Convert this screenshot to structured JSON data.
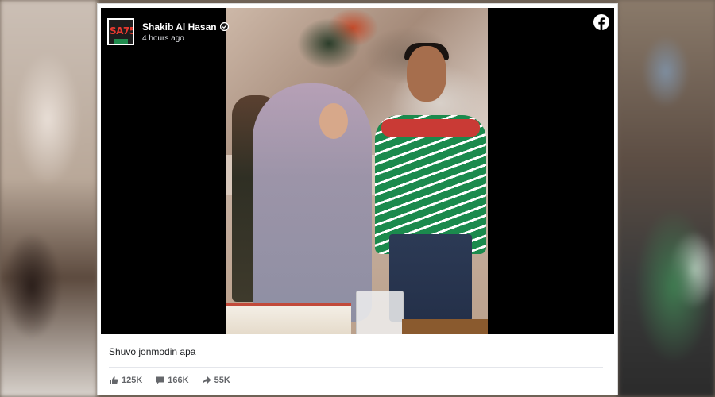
{
  "post": {
    "page_name": "Shakib Al Hasan",
    "timestamp": "4 hours ago",
    "avatar_text": "SA75",
    "caption": "Shuvo jonmodin apa"
  },
  "stats": {
    "likes": "125K",
    "comments": "166K",
    "shares": "55K"
  },
  "icons": {
    "brand": "facebook-icon",
    "verified": "verified-badge-icon",
    "like": "thumbs-up-icon",
    "comment": "comment-icon",
    "share": "share-arrow-icon"
  },
  "colors": {
    "facebook_white": "#ffffff",
    "media_background": "#000000",
    "meta_text": "#65676b"
  }
}
